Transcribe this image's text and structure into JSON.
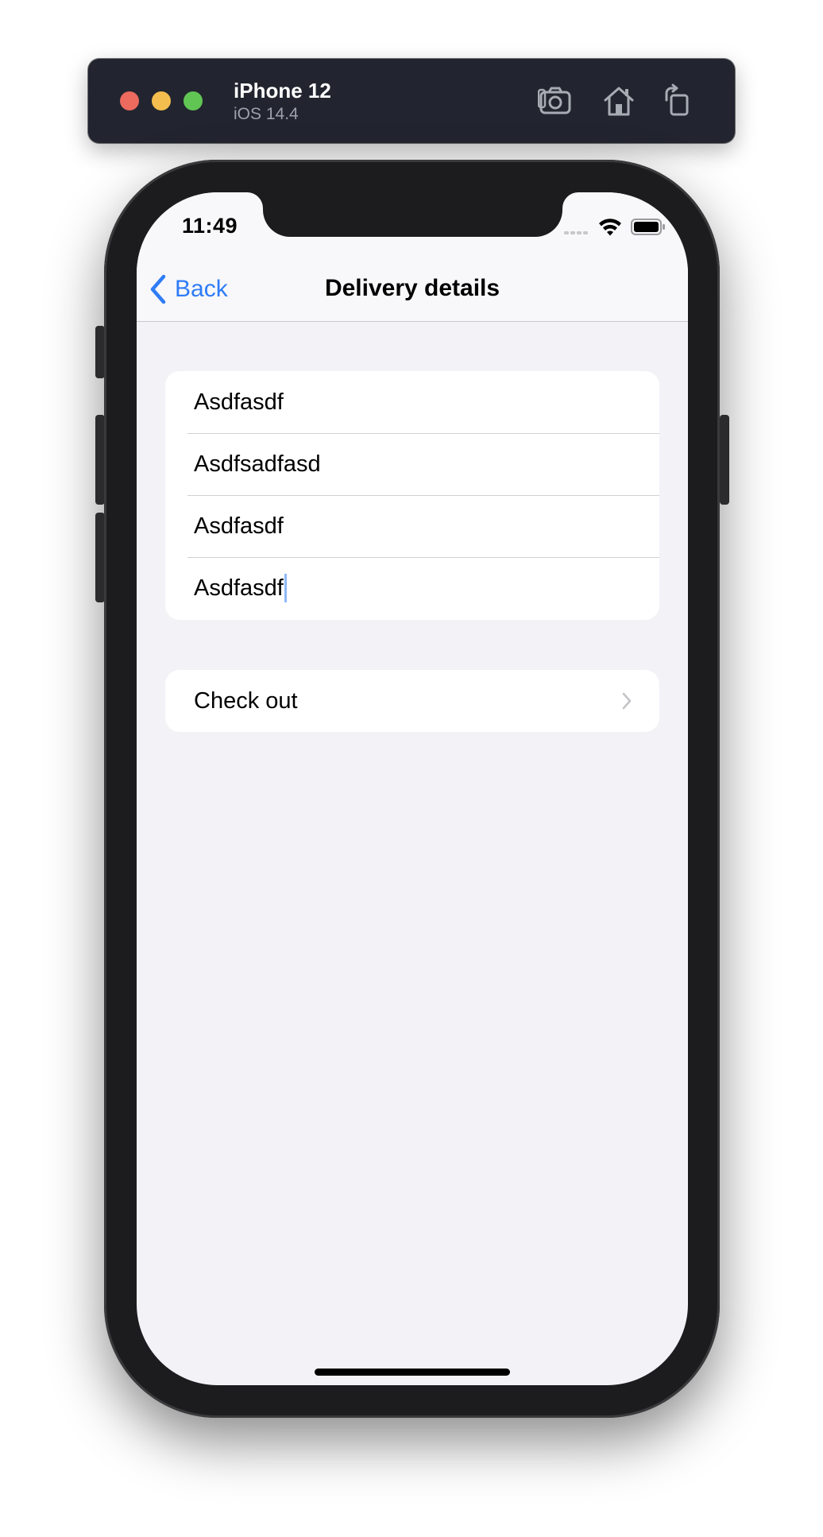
{
  "simulator": {
    "device_name": "iPhone 12",
    "os_version": "iOS 14.4",
    "tools": [
      "camera-icon",
      "home-icon",
      "rotate-icon"
    ]
  },
  "status_bar": {
    "time": "11:49"
  },
  "navigation": {
    "back_label": "Back",
    "title": "Delivery details"
  },
  "form": {
    "fields": [
      {
        "value": "Asdfasdf"
      },
      {
        "value": "Asdfsadfasd"
      },
      {
        "value": "Asdfasdf"
      },
      {
        "value": "Asdfasdf",
        "focused": true
      }
    ]
  },
  "actions": {
    "checkout_label": "Check out"
  },
  "colors": {
    "accent": "#2f7cf6",
    "grouped_background": "#f2f2f7",
    "cell_background": "#ffffff",
    "separator": "#d1d1d6",
    "simulator_bar": "#22252f"
  }
}
